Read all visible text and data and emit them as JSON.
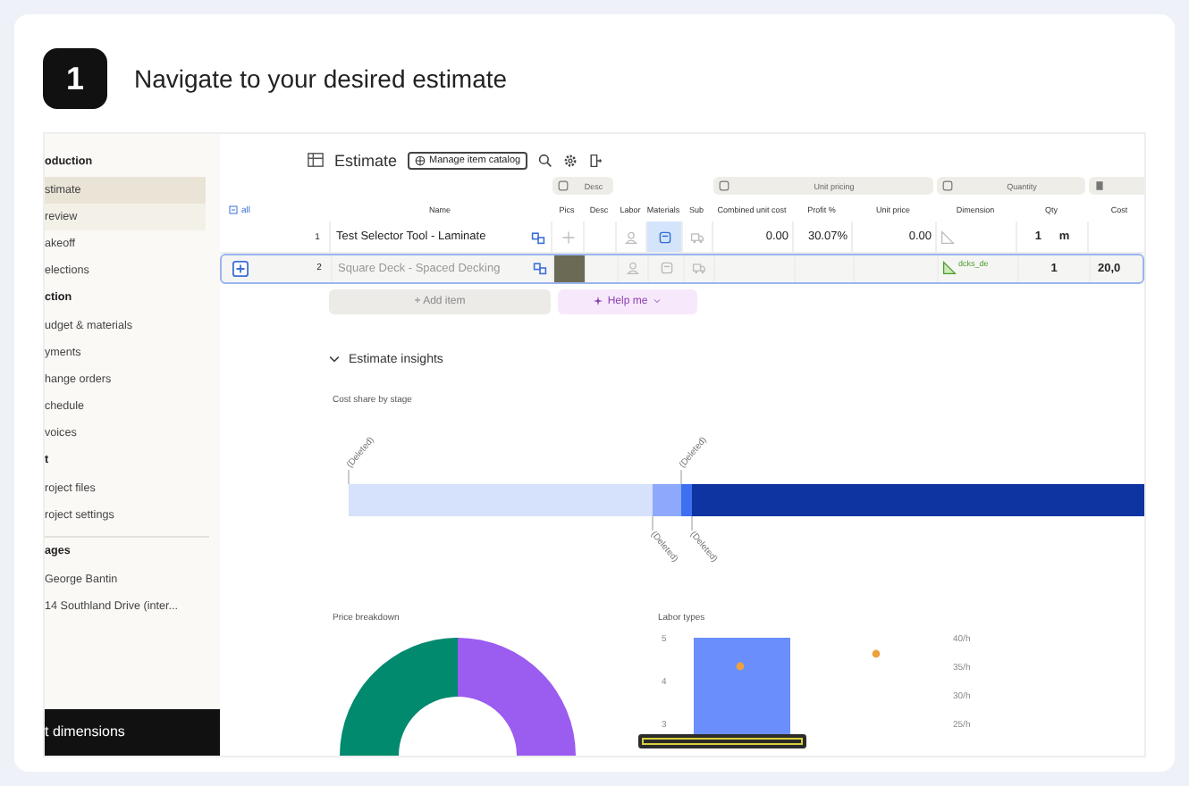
{
  "step": {
    "number": "1",
    "title": "Navigate to your desired estimate"
  },
  "sidebar": {
    "sections": [
      {
        "title": "oduction",
        "items": [
          {
            "label": "stimate",
            "selected": true,
            "hovered": false
          },
          {
            "label": "review",
            "selected": false,
            "hovered": true
          },
          {
            "label": "akeoff",
            "selected": false,
            "hovered": false
          },
          {
            "label": "elections",
            "selected": false,
            "hovered": false
          }
        ]
      },
      {
        "title": "ction",
        "items": [
          {
            "label": "udget & materials",
            "selected": false,
            "hovered": false
          },
          {
            "label": "yments",
            "selected": false,
            "hovered": false
          },
          {
            "label": "hange orders",
            "selected": false,
            "hovered": false
          },
          {
            "label": "chedule",
            "selected": false,
            "hovered": false
          },
          {
            "label": "voices",
            "selected": false,
            "hovered": false
          }
        ]
      },
      {
        "title": "t",
        "items": [
          {
            "label": "roject files",
            "selected": false,
            "hovered": false
          },
          {
            "label": "roject settings",
            "selected": false,
            "hovered": false
          }
        ]
      },
      {
        "title": "ages",
        "items": [
          {
            "label": "George Bantin",
            "selected": false,
            "hovered": false
          },
          {
            "label": "14 Southland Drive (inter...",
            "selected": false,
            "hovered": false
          }
        ]
      }
    ],
    "footer": "t dimensions"
  },
  "toolbar": {
    "title": "Estimate",
    "catalog_button": "Manage item catalog"
  },
  "table": {
    "expand_all": "all",
    "groups": [
      "Desc",
      "Unit pricing",
      "Quantity"
    ],
    "columns": [
      "Name",
      "Pics",
      "Desc",
      "Labor",
      "Materials",
      "Sub",
      "Combined unit cost",
      "Profit %",
      "Unit price",
      "Dimension",
      "Qty",
      "Cost"
    ],
    "rows": [
      {
        "index": "1",
        "name": "Test Selector Tool - Laminate",
        "selected": false,
        "materials_linked": true,
        "has_photo": false,
        "combined_unit_cost": "0.00",
        "profit": "30.07%",
        "unit_price": "0.00",
        "dimension": "",
        "qty": "1",
        "unit": "m",
        "cost": ""
      },
      {
        "index": "2",
        "name": "Square Deck - Spaced Decking",
        "selected": true,
        "materials_linked": false,
        "has_photo": true,
        "combined_unit_cost": "",
        "profit": "",
        "unit_price": "",
        "dimension": "dcks_de",
        "qty": "1",
        "unit": "",
        "cost": "20,0"
      }
    ],
    "add_item": "+ Add item",
    "help": "Help me"
  },
  "insights": {
    "title": "Estimate insights",
    "expanded": true,
    "cost_share": {
      "title": "Cost share by stage",
      "labels": [
        "(Deleted)",
        "(Deleted)",
        "(Deleted)",
        "(Deleted)"
      ]
    },
    "price_breakdown": {
      "title": "Price breakdown"
    },
    "labor_types": {
      "title": "Labor types",
      "left_axis_labels": [
        "5",
        "4",
        "3"
      ],
      "right_axis_labels": [
        "40/h",
        "35/h",
        "30/h",
        "25/h"
      ]
    }
  }
}
